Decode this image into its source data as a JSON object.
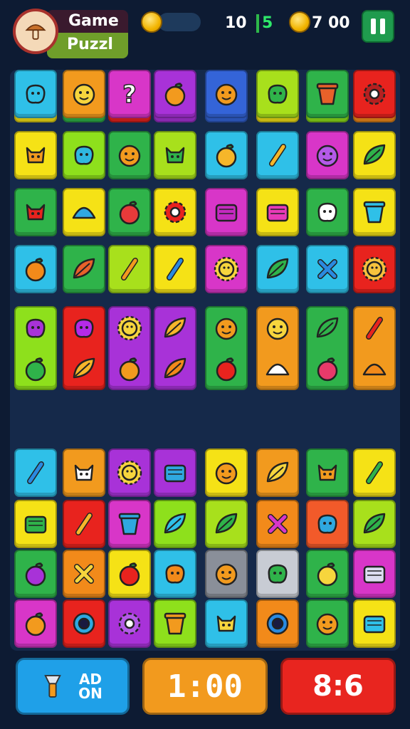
{
  "header": {
    "title_line1": "Game",
    "title_line2": "Puzzl",
    "logo_icon": "mushroom-logo-icon",
    "coin_icon": "coin-icon",
    "stat_left": "10",
    "stat_mid": "5",
    "coins_value": "7 00",
    "pause_icon": "pause-icon"
  },
  "board": {
    "tiles": [
      {
        "color": "#f5e216",
        "glyph": "#3fc6c1",
        "shape": "blob"
      },
      {
        "color": "#2fb34a",
        "glyph": "#e8612a",
        "shape": "creature"
      },
      {
        "color": "#e8231e",
        "glyph": "#f6d53d",
        "shape": "blob"
      },
      {
        "color": "#a832d8",
        "glyph": "#f6a22a",
        "shape": "face"
      },
      {
        "color": "#3464d8",
        "glyph": "#f29a1e",
        "shape": "dome"
      },
      {
        "color": "#f5e216",
        "glyph": "#e02020",
        "shape": "apple"
      },
      {
        "color": "#8ee01c",
        "glyph": "#2aa84a",
        "shape": "leaf"
      },
      {
        "color": "#f28a1a",
        "glyph": "#9a3ae0",
        "shape": "creature"
      },
      {
        "color": "#f5e216",
        "glyph": "#f29a1e",
        "shape": "creature"
      },
      {
        "color": "#8ee01c",
        "glyph": "#2fb8e0",
        "shape": "blob"
      },
      {
        "color": "#2fb34a",
        "glyph": "#f29a1e",
        "shape": "face"
      },
      {
        "color": "#a8e01c",
        "glyph": "#2fb34a",
        "shape": "creature"
      },
      {
        "color": "#2fc0e8",
        "glyph": "#f6b62a",
        "shape": "apple"
      },
      {
        "color": "#2fc0e8",
        "glyph": "#f6b62a",
        "shape": "stick"
      },
      {
        "color": "#d836c8",
        "glyph": "#b45ae8",
        "shape": "face"
      },
      {
        "color": "#f5e216",
        "glyph": "#2fb34a",
        "shape": "leaf"
      },
      {
        "color": "#2fb34a",
        "glyph": "#e8231e",
        "shape": "creature"
      },
      {
        "color": "#f5e216",
        "glyph": "#2fa8e0",
        "shape": "dome"
      },
      {
        "color": "#2fb34a",
        "glyph": "#e83a3a",
        "shape": "apple"
      },
      {
        "color": "#f5e216",
        "glyph": "#e8231e",
        "shape": "gear"
      },
      {
        "color": "#d836c8",
        "glyph": "#c42ac0",
        "shape": "box"
      },
      {
        "color": "#f5e216",
        "glyph": "#e83ab8",
        "shape": "box"
      },
      {
        "color": "#2fb34a",
        "glyph": "#ffffff",
        "shape": "blob"
      },
      {
        "color": "#f5e216",
        "glyph": "#2fc0e8",
        "shape": "cup"
      },
      {
        "color": "#2fc0e8",
        "glyph": "#f28a1a",
        "shape": "apple"
      },
      {
        "color": "#2fb34a",
        "glyph": "#e8612a",
        "shape": "leaf"
      },
      {
        "color": "#a8e01c",
        "glyph": "#f29a1e",
        "shape": "stick"
      },
      {
        "color": "#f5e216",
        "glyph": "#2a8ae0",
        "shape": "stick"
      },
      {
        "color": "#d836c8",
        "glyph": "#f6d53d",
        "shape": "sun"
      },
      {
        "color": "#2fc0e8",
        "glyph": "#2fb34a",
        "shape": "leaf"
      },
      {
        "color": "#2fc0e8",
        "glyph": "#2a8ae0",
        "shape": "cross"
      },
      {
        "color": "#e8231e",
        "glyph": "#f6c23d",
        "shape": "sun"
      },
      {
        "color": "#8ee01c",
        "glyph": "#a832d8",
        "shape": "blob",
        "tall": true,
        "glyph2": "#2fb34a",
        "shape2": "apple"
      },
      {
        "color": "#e8231e",
        "glyph": "#b42ae8",
        "shape": "blob",
        "tall": true,
        "glyph2": "#f6b62a",
        "shape2": "leaf"
      },
      {
        "color": "#a832d8",
        "glyph": "#f6d53d",
        "shape": "sun",
        "tall": true,
        "glyph2": "#f29a1e",
        "shape2": "apple"
      },
      {
        "color": "#a832d8",
        "glyph": "#f6b62a",
        "shape": "leaf",
        "tall": true,
        "glyph2": "#f28a1a",
        "shape2": "leaf"
      },
      {
        "color": "#2fb34a",
        "glyph": "#f29a1e",
        "shape": "face",
        "tall": true,
        "glyph2": "#e8231e",
        "shape2": "apple"
      },
      {
        "color": "#f29a1e",
        "glyph": "#f6d53d",
        "shape": "face",
        "tall": true,
        "glyph2": "#ffffff",
        "shape2": "dome"
      },
      {
        "color": "#2fb34a",
        "glyph": "#2fb34a",
        "shape": "leaf",
        "tall": true,
        "glyph2": "#e83a6a",
        "shape2": "apple"
      },
      {
        "color": "#f29a1e",
        "glyph": "#e8231e",
        "shape": "stick",
        "tall": true,
        "glyph2": "#f28a1a",
        "shape2": "dome"
      },
      {
        "color": "#2fc0e8",
        "glyph": "#2a8ae0",
        "shape": "stick"
      },
      {
        "color": "#f29a1e",
        "glyph": "#ffffff",
        "shape": "creature"
      },
      {
        "color": "#a832d8",
        "glyph": "#f6d53d",
        "shape": "sun"
      },
      {
        "color": "#a832d8",
        "glyph": "#2fa8e0",
        "shape": "box"
      },
      {
        "color": "#f5e216",
        "glyph": "#f29a1e",
        "shape": "face"
      },
      {
        "color": "#f29a1e",
        "glyph": "#f6d53d",
        "shape": "leaf"
      },
      {
        "color": "#2fb34a",
        "glyph": "#f29a1e",
        "shape": "creature"
      },
      {
        "color": "#f5e216",
        "glyph": "#2fb34a",
        "shape": "stick"
      },
      {
        "color": "#f5e216",
        "glyph": "#2fb34a",
        "shape": "box"
      },
      {
        "color": "#e8231e",
        "glyph": "#f6b62a",
        "shape": "stick"
      },
      {
        "color": "#d836c8",
        "glyph": "#2fa8e0",
        "shape": "cup"
      },
      {
        "color": "#8ee01c",
        "glyph": "#2fc0e8",
        "shape": "leaf"
      },
      {
        "color": "#a8e01c",
        "glyph": "#2fb34a",
        "shape": "leaf"
      },
      {
        "color": "#f28a1a",
        "glyph": "#d836c8",
        "shape": "cross"
      },
      {
        "color": "#f25a2a",
        "glyph": "#2fa8e0",
        "shape": "blob"
      },
      {
        "color": "#a8e01c",
        "glyph": "#2fb34a",
        "shape": "leaf"
      },
      {
        "color": "#2fb34a",
        "glyph": "#a832d8",
        "shape": "apple"
      },
      {
        "color": "#f28a1a",
        "glyph": "#f6d53d",
        "shape": "cross"
      },
      {
        "color": "#f5e216",
        "glyph": "#e8231e",
        "shape": "apple"
      },
      {
        "color": "#2fc0e8",
        "glyph": "#f28a1a",
        "shape": "blob"
      },
      {
        "color": "#8a8f99",
        "glyph": "#f29a1e",
        "shape": "face"
      },
      {
        "color": "#c8ccd4",
        "glyph": "#2fb34a",
        "shape": "blob"
      },
      {
        "color": "#2fb34a",
        "glyph": "#f6d53d",
        "shape": "apple"
      },
      {
        "color": "#d836c8",
        "glyph": "#dcdcf0",
        "shape": "box"
      },
      {
        "color": "#d836c8",
        "glyph": "#f29a1e",
        "shape": "apple"
      },
      {
        "color": "#e8231e",
        "glyph": "#2fa8e0",
        "shape": "ring"
      },
      {
        "color": "#a832d8",
        "glyph": "#b45ae8",
        "shape": "gear"
      },
      {
        "color": "#8ee01c",
        "glyph": "#f29a1e",
        "shape": "cup"
      },
      {
        "color": "#2fc0e8",
        "glyph": "#f6d53d",
        "shape": "creature"
      },
      {
        "color": "#f28a1a",
        "glyph": "#2a8ae0",
        "shape": "ring"
      },
      {
        "color": "#2fb34a",
        "glyph": "#f29a1e",
        "shape": "face"
      },
      {
        "color": "#f5e216",
        "glyph": "#2fc0e8",
        "shape": "box"
      },
      {
        "color": "#2fc0e8",
        "glyph": "#2fc0e8",
        "shape": "blob"
      },
      {
        "color": "#f29a1e",
        "glyph": "#f6d53d",
        "shape": "face"
      },
      {
        "color": "#d836c8",
        "glyph": "#ffffff",
        "shape": "question"
      },
      {
        "color": "#a832d8",
        "glyph": "#f29a1e",
        "shape": "apple"
      },
      {
        "color": "#3464d8",
        "glyph": "#f29a1e",
        "shape": "face"
      },
      {
        "color": "#a8e01c",
        "glyph": "#2fb34a",
        "shape": "blob"
      },
      {
        "color": "#2fb34a",
        "glyph": "#e8612a",
        "shape": "cup"
      },
      {
        "color": "#e8231e",
        "glyph": "#b42020",
        "shape": "gear"
      }
    ]
  },
  "footer": {
    "hint_icon": "flashlight-icon",
    "hint_label_line1": "AD",
    "hint_label_line2": "ON",
    "timer": "1:00",
    "score": "8:6"
  }
}
